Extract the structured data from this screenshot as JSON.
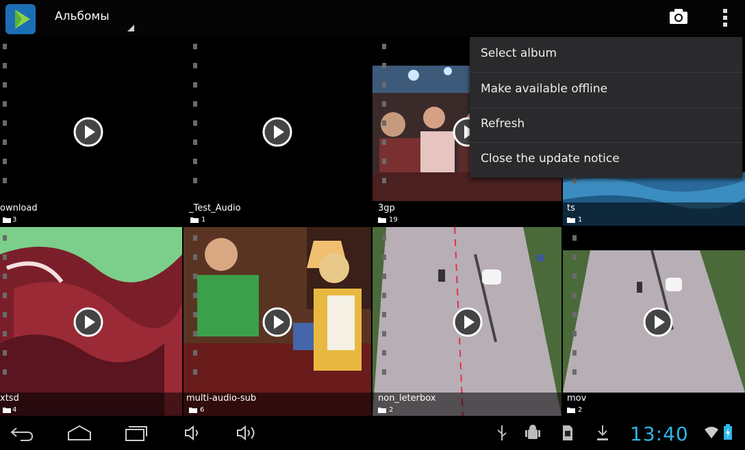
{
  "actionbar": {
    "title": "Альбомы",
    "icons": [
      "app-logo-icon",
      "camera-icon",
      "overflow-menu-icon"
    ]
  },
  "albums": [
    {
      "name": "ownload",
      "count": "3"
    },
    {
      "name": "_Test_Audio",
      "count": "1"
    },
    {
      "name": "3gp",
      "count": "19"
    },
    {
      "name": "ts",
      "count": "1"
    },
    {
      "name": "xtsd",
      "count": "4"
    },
    {
      "name": "multi-audio-sub",
      "count": "6"
    },
    {
      "name": "non_leterbox",
      "count": "2"
    },
    {
      "name": "mov",
      "count": "2"
    }
  ],
  "menu": {
    "items": [
      {
        "label": "Select album"
      },
      {
        "label": "Make available offline"
      },
      {
        "label": "Refresh"
      },
      {
        "label": "Close the update notice"
      }
    ]
  },
  "statusbar": {
    "time": "13:40",
    "accent": "#2fb5e8"
  }
}
